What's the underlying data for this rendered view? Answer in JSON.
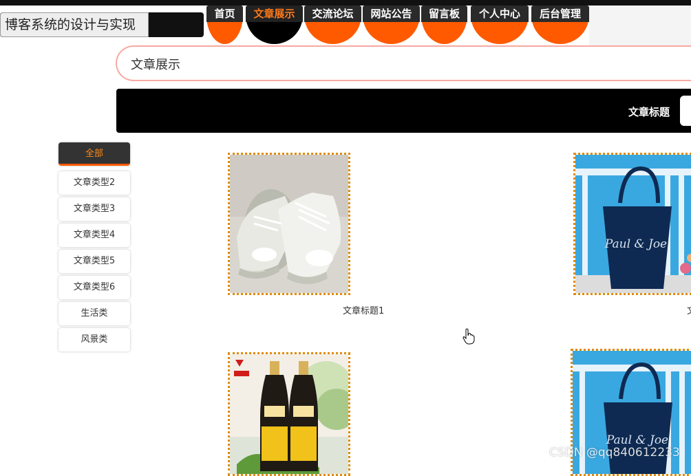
{
  "site": {
    "logo_text": "博客系统的设计与实现"
  },
  "nav": {
    "items": [
      {
        "label": "首页"
      },
      {
        "label": "文章展示"
      },
      {
        "label": "交流论坛"
      },
      {
        "label": "网站公告"
      },
      {
        "label": "留言板"
      },
      {
        "label": "个人中心"
      },
      {
        "label": "后台管理"
      }
    ],
    "active_index": 1,
    "accent": "#ff5a00"
  },
  "page": {
    "title": "文章展示"
  },
  "search": {
    "label": "文章标题",
    "value": ""
  },
  "categories": [
    {
      "label": "全部",
      "active": true
    },
    {
      "label": "文章类型2"
    },
    {
      "label": "文章类型3"
    },
    {
      "label": "文章类型4"
    },
    {
      "label": "文章类型5"
    },
    {
      "label": "文章类型6"
    },
    {
      "label": "生活类"
    },
    {
      "label": "风景类"
    }
  ],
  "articles": [
    {
      "title": "文章标题1",
      "image": "silver-sneakers-photo"
    },
    {
      "title": "文",
      "image": "navy-tote-bag-photo"
    },
    {
      "title": "",
      "image": "soy-sauce-bottles-photo"
    },
    {
      "title": "",
      "image": "navy-tote-bag-photo"
    }
  ],
  "watermark": "CSDN @qq840612233"
}
